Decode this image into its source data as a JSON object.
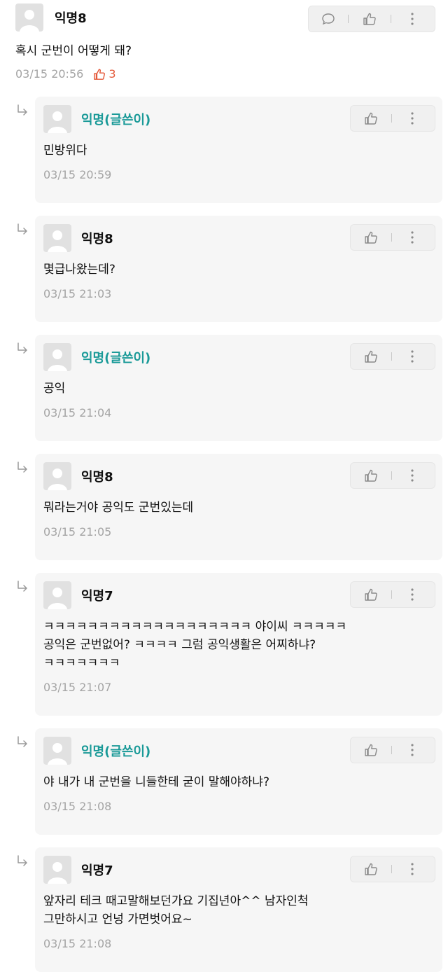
{
  "main_comment": {
    "author": "익명8",
    "text": "혹시 군번이 어떻게 돼?",
    "time": "03/15 20:56",
    "likes": "3",
    "accent": "#e45a3b"
  },
  "replies": [
    {
      "author": "익명(글쓴이)",
      "is_op": true,
      "text": [
        "민방위다"
      ],
      "time": "03/15 20:59"
    },
    {
      "author": "익명8",
      "is_op": false,
      "text": [
        "몇급나왔는데?"
      ],
      "time": "03/15 21:03"
    },
    {
      "author": "익명(글쓴이)",
      "is_op": true,
      "text": [
        "공익"
      ],
      "time": "03/15 21:04"
    },
    {
      "author": "익명8",
      "is_op": false,
      "text": [
        "뭐라는거야 공익도 군번있는데"
      ],
      "time": "03/15 21:05"
    },
    {
      "author": "익명7",
      "is_op": false,
      "text": [
        "ㅋㅋㅋㅋㅋㅋㅋㅋㅋㅋㅋㅋㅋㅋㅋㅋㅋㅋㅋ 야이씨 ㅋㅋㅋㅋㅋ",
        "공익은 군번없어? ㅋㅋㅋㅋ 그럼 공익생활은 어찌하냐?",
        "ㅋㅋㅋㅋㅋㅋㅋ"
      ],
      "time": "03/15 21:07"
    },
    {
      "author": "익명(글쓴이)",
      "is_op": true,
      "text": [
        "야 내가 내 군번을 니들한테 굳이 말해야하냐?"
      ],
      "time": "03/15 21:08"
    },
    {
      "author": "익명7",
      "is_op": false,
      "text": [
        "앞자리 테크 때고말해보던가요 기집년아^^ 남자인척",
        "그만하시고 언넝 가면벗어요~"
      ],
      "time": "03/15 21:08"
    }
  ],
  "colors": {
    "op_name": "#1a9a98",
    "time": "#a4a4a4",
    "card_bg": "#f6f6f6"
  },
  "icons": [
    "avatar-placeholder-icon",
    "comment-icon",
    "thumbs-up-icon",
    "more-icon",
    "reply-arrow-icon"
  ]
}
